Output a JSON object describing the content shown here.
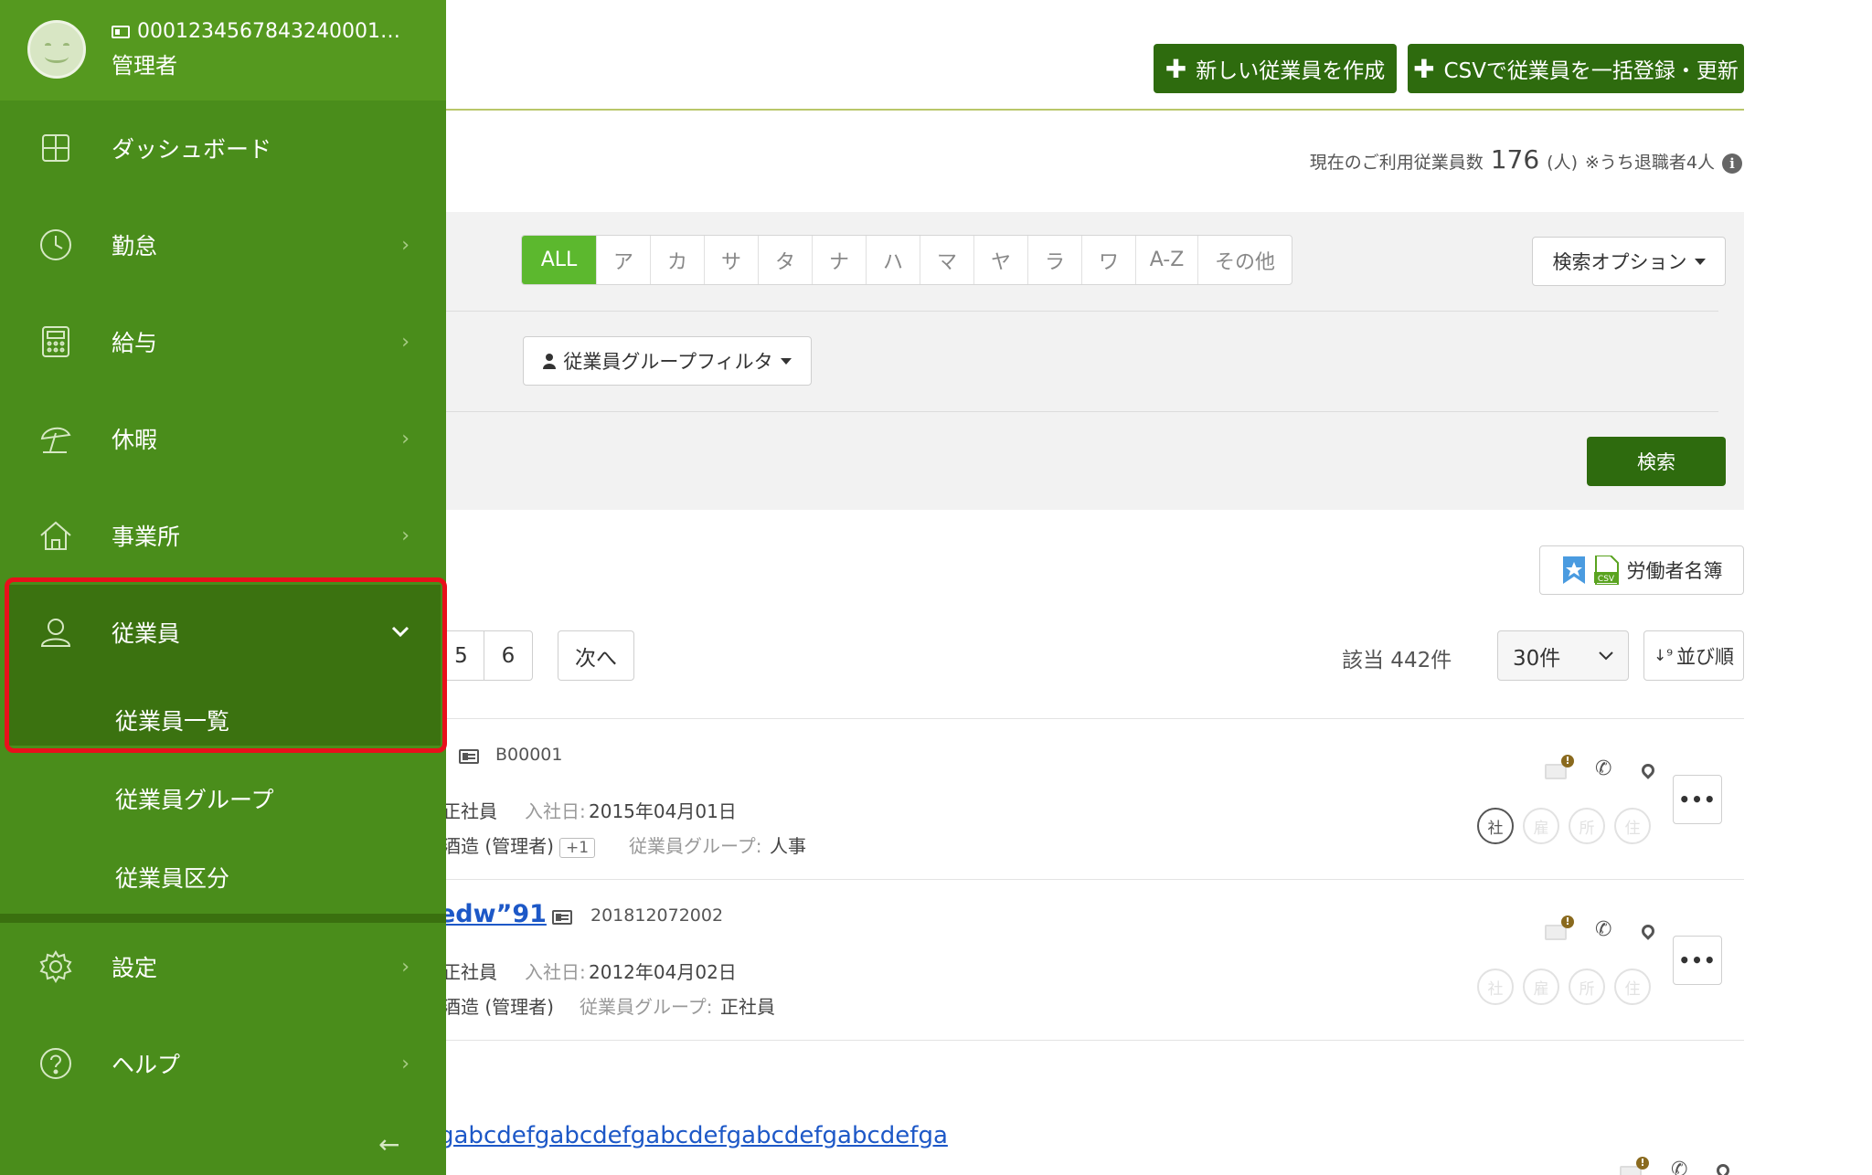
{
  "header": {
    "create_button": "新しい従業員を作成",
    "csv_button": "CSVで従業員を一括登録・更新",
    "plus_glyph": "✚"
  },
  "usage": {
    "prefix": "現在のご利用従業員数",
    "count": "176",
    "unit": "(人)",
    "note": "※うち退職者4人",
    "info_glyph": "i"
  },
  "search": {
    "kana_tabs": [
      "ALL",
      "ア",
      "カ",
      "サ",
      "タ",
      "ナ",
      "ハ",
      "マ",
      "ヤ",
      "ラ",
      "ワ",
      "A-Z",
      "その他"
    ],
    "active_tab": "ALL",
    "options_label": "検索オプション",
    "group_filter_label": "従業員グループフィルタ",
    "search_button": "検索"
  },
  "toolbar": {
    "roster_label": "労働者名簿",
    "csv_tag": "CSV"
  },
  "pagination": {
    "pages": [
      "5",
      "6"
    ],
    "next_label": "次へ",
    "hit_label": "該当 442件",
    "per_page": "30件",
    "sort_label": "並び順",
    "sort_glyph": "↓⁹"
  },
  "rows": [
    {
      "id": "B00001",
      "type": "正社員",
      "hire_label": "入社日:",
      "hire_date": "2015年04月01日",
      "office": "酒造 (管理者)",
      "extra": "+1",
      "group_label": "従業員グループ:",
      "group": "人事",
      "badges": [
        "社",
        "雇",
        "所",
        "住"
      ],
      "more": "•••"
    },
    {
      "name_fragment": "edw”91",
      "id": "201812072002",
      "type": "正社員",
      "hire_label": "入社日:",
      "hire_date": "2012年04月02日",
      "office": "酒造 (管理者)",
      "group_label": "従業員グループ:",
      "group": "正社員",
      "badges": [
        "社",
        "雇",
        "所",
        "住"
      ],
      "more": "•••"
    },
    {
      "name_fragment": "gabcdefgabcdefgabcdefgabcdefgabcdefga"
    }
  ],
  "sidebar": {
    "user_id": "0001234567843240001…",
    "role": "管理者",
    "items": {
      "dashboard": "ダッシュボード",
      "attendance": "勤怠",
      "payroll": "給与",
      "leave": "休暇",
      "office": "事業所",
      "employees": "従業員",
      "employee_list": "従業員一覧",
      "employee_groups": "従業員グループ",
      "employee_classes": "従業員区分",
      "settings": "設定",
      "help": "ヘルプ"
    },
    "collapse_glyph": "←"
  },
  "colors": {
    "sidebar": "#4a8d1b",
    "sidebar_active": "#3b7210",
    "brand_button": "#2e6b0e",
    "kana_active": "#5cb82e",
    "highlight": "#e8101b",
    "link": "#1d58c7"
  },
  "icons": {
    "dashboard": "grid-icon",
    "attendance": "clock-icon",
    "payroll": "calculator-icon",
    "leave": "umbrella-icon",
    "office": "home-icon",
    "employees": "user-icon",
    "settings": "gear-icon",
    "help": "question-icon"
  }
}
